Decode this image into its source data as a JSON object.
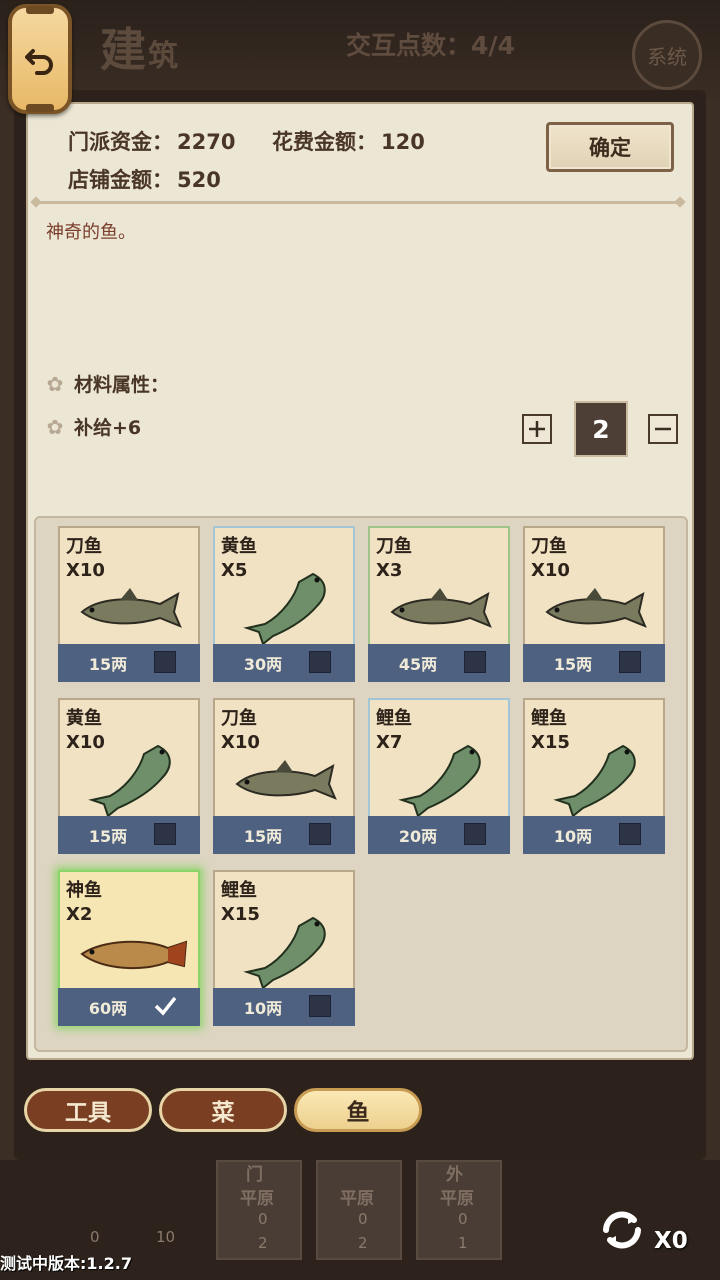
{
  "header": {
    "title": "建",
    "title_small": "筑",
    "action_points": "交互点数：4/4",
    "system_label": "系统"
  },
  "funds": {
    "sect_funds_label": "门派资金：",
    "sect_funds_value": "2270",
    "cost_label": "花费金额：",
    "cost_value": "120",
    "shop_label": "店铺金额：",
    "shop_value": "520",
    "confirm_label": "确定"
  },
  "item": {
    "description": "神奇的鱼。",
    "attr_title": "材料属性：",
    "attr_value": "补给+6",
    "quantity": "2"
  },
  "inventory": [
    {
      "name": "刀鱼",
      "count": "X10",
      "price": "15两",
      "fish": "knife",
      "border": "normal",
      "checked": false
    },
    {
      "name": "黄鱼",
      "count": "X5",
      "price": "30两",
      "fish": "carp",
      "border": "blue",
      "checked": false
    },
    {
      "name": "刀鱼",
      "count": "X3",
      "price": "45两",
      "fish": "knife",
      "border": "green",
      "checked": false
    },
    {
      "name": "刀鱼",
      "count": "X10",
      "price": "15两",
      "fish": "knife",
      "border": "normal",
      "checked": false
    },
    {
      "name": "黄鱼",
      "count": "X10",
      "price": "15两",
      "fish": "carp",
      "border": "normal",
      "checked": false
    },
    {
      "name": "刀鱼",
      "count": "X10",
      "price": "15两",
      "fish": "knife",
      "border": "normal",
      "checked": false
    },
    {
      "name": "鲤鱼",
      "count": "X7",
      "price": "20两",
      "fish": "carp",
      "border": "blue",
      "checked": false
    },
    {
      "name": "鲤鱼",
      "count": "X15",
      "price": "10两",
      "fish": "carp",
      "border": "normal",
      "checked": false
    },
    {
      "name": "神鱼",
      "count": "X2",
      "price": "60两",
      "fish": "arowana",
      "border": "selected",
      "checked": true
    },
    {
      "name": "鲤鱼",
      "count": "X15",
      "price": "10两",
      "fish": "carp",
      "border": "normal",
      "checked": false
    }
  ],
  "tabs": [
    {
      "label": "工具",
      "active": false
    },
    {
      "label": "菜",
      "active": false
    },
    {
      "label": "鱼",
      "active": true
    }
  ],
  "bottom": {
    "buildings": [
      {
        "label": "门",
        "terrain": "平原",
        "flag": "0",
        "people": "2"
      },
      {
        "label": "",
        "terrain": "平原",
        "flag": "0",
        "people": "2"
      },
      {
        "label": "外",
        "terrain": "平原",
        "flag": "0",
        "people": "1"
      }
    ],
    "left_counts": {
      "flag": "0",
      "people": "10"
    },
    "refresh_count": "X0",
    "version": "测试中版本:1.2.7"
  },
  "colors": {
    "bar_blue": "#4e6181",
    "selected_glow": "#8bd46a",
    "tab_brown": "#7a3f22",
    "tab_active": "#ecd08e"
  }
}
